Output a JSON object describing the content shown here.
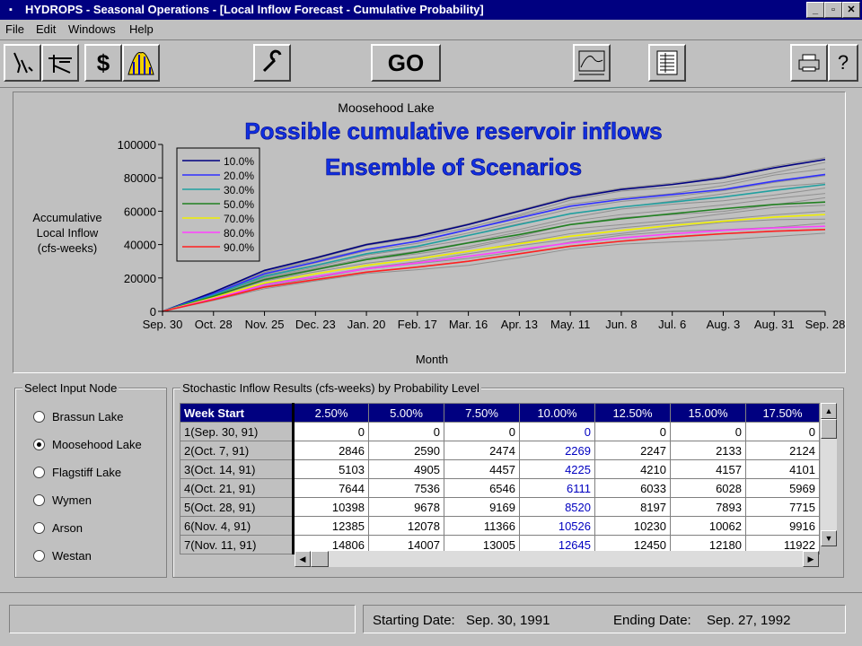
{
  "window": {
    "title": "HYDROPS - Seasonal Operations - [Local Inflow Forecast - Cumulative Probability]",
    "minimize_label": "_",
    "restore_label": "▫",
    "close_label": "✕"
  },
  "menu": [
    "File",
    "Edit",
    "Windows",
    "Help"
  ],
  "toolbar": {
    "go_label": "GO",
    "icons": [
      "inflow-icon",
      "reservoir-icon",
      "dollar-icon",
      "probability-icon",
      "wrench-icon",
      "hydrograph-icon",
      "table-icon",
      "printer-icon",
      "help-icon"
    ],
    "dollar_label": "$",
    "help_label": "?"
  },
  "chart_data": {
    "type": "line",
    "title": "Moosehood Lake",
    "overlay_title_1": "Possible cumulative reservoir inflows",
    "overlay_title_2": "Ensemble of Scenarios",
    "xlabel": "Month",
    "ylabel": [
      "Accumulative",
      "Local Inflow",
      "(cfs-weeks)"
    ],
    "x_ticks": [
      "Sep. 30",
      "Oct. 28",
      "Nov. 25",
      "Dec. 23",
      "Jan. 20",
      "Feb. 17",
      "Mar. 16",
      "Apr. 13",
      "May. 11",
      "Jun. 8",
      "Jul. 6",
      "Aug. 3",
      "Aug. 31",
      "Sep. 28"
    ],
    "y_ticks": [
      0,
      20000,
      40000,
      60000,
      80000,
      100000
    ],
    "ylim": [
      0,
      100000
    ],
    "grid": false,
    "legend_position": "top-left",
    "series": [
      {
        "name": "10.0%",
        "color": "#000080",
        "values": [
          0,
          11500,
          24500,
          32000,
          40000,
          45000,
          52000,
          60000,
          68000,
          73000,
          76000,
          80000,
          86000,
          91000
        ]
      },
      {
        "name": "20.0%",
        "color": "#3030ff",
        "values": [
          0,
          10500,
          22500,
          29500,
          37000,
          42000,
          49000,
          56000,
          63000,
          67000,
          70000,
          73000,
          78000,
          82000
        ]
      },
      {
        "name": "30.0%",
        "color": "#20a0a0",
        "values": [
          0,
          9800,
          21000,
          27500,
          34500,
          39000,
          45500,
          52000,
          58500,
          62500,
          65500,
          68500,
          72500,
          76000
        ]
      },
      {
        "name": "50.0%",
        "color": "#208020",
        "values": [
          0,
          9000,
          19000,
          25000,
          31000,
          35500,
          41000,
          46000,
          52000,
          55500,
          58500,
          61500,
          64000,
          65500
        ]
      },
      {
        "name": "70.0%",
        "color": "#f0f000",
        "values": [
          0,
          8200,
          17000,
          22500,
          27500,
          31500,
          36000,
          40500,
          45000,
          48500,
          51500,
          54000,
          56500,
          58000
        ]
      },
      {
        "name": "80.0%",
        "color": "#ff40ff",
        "values": [
          0,
          7600,
          15800,
          20800,
          25500,
          29000,
          33000,
          37000,
          41000,
          44000,
          46500,
          48500,
          50000,
          51000
        ]
      },
      {
        "name": "90.0%",
        "color": "#ff2020",
        "values": [
          0,
          7000,
          14500,
          19000,
          23500,
          26500,
          30000,
          34500,
          39000,
          42000,
          44500,
          46500,
          48000,
          49000
        ]
      }
    ],
    "ensemble_color": "#909090"
  },
  "input_node": {
    "label": "Select Input Node",
    "options": [
      "Brassun Lake",
      "Moosehood Lake",
      "Flagstiff Lake",
      "Wymen",
      "Arson",
      "Westan"
    ],
    "selected": "Moosehood Lake"
  },
  "results": {
    "label": "Stochastic Inflow Results (cfs-weeks) by Probability Level",
    "columns": [
      "Week Start",
      "2.50%",
      "5.00%",
      "7.50%",
      "10.00%",
      "12.50%",
      "15.00%",
      "17.50%"
    ],
    "highlight_column": "10.00%",
    "rows": [
      [
        "1(Sep. 30, 91)",
        "0",
        "0",
        "0",
        "0",
        "0",
        "0",
        "0"
      ],
      [
        "2(Oct. 7, 91)",
        "2846",
        "2590",
        "2474",
        "2269",
        "2247",
        "2133",
        "2124"
      ],
      [
        "3(Oct. 14, 91)",
        "5103",
        "4905",
        "4457",
        "4225",
        "4210",
        "4157",
        "4101"
      ],
      [
        "4(Oct. 21, 91)",
        "7644",
        "7536",
        "6546",
        "6111",
        "6033",
        "6028",
        "5969"
      ],
      [
        "5(Oct. 28, 91)",
        "10398",
        "9678",
        "9169",
        "8520",
        "8197",
        "7893",
        "7715"
      ],
      [
        "6(Nov. 4, 91)",
        "12385",
        "12078",
        "11366",
        "10526",
        "10230",
        "10062",
        "9916"
      ],
      [
        "7(Nov. 11, 91)",
        "14806",
        "14007",
        "13005",
        "12645",
        "12450",
        "12180",
        "11922"
      ]
    ]
  },
  "status": {
    "message": "",
    "starting_label": "Starting Date:",
    "starting_value": "Sep. 30, 1991",
    "ending_label": "Ending Date:",
    "ending_value": "Sep. 27, 1992"
  }
}
